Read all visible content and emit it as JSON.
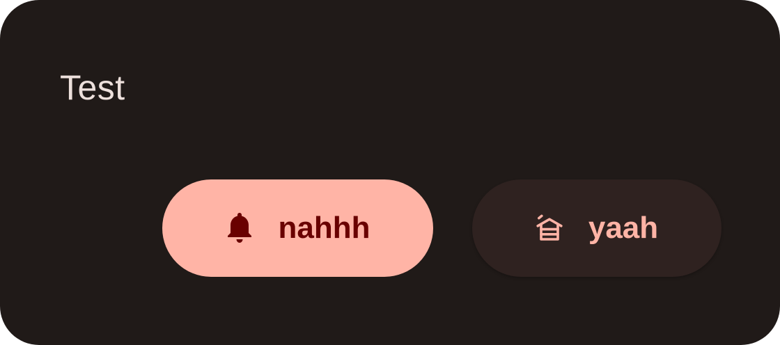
{
  "dialog": {
    "title": "Test"
  },
  "buttons": {
    "primary": {
      "label": "nahhh",
      "icon": "bell-icon"
    },
    "secondary": {
      "label": "yaah",
      "icon": "cabin-icon"
    }
  },
  "colors": {
    "surface": "#201a18",
    "on_surface": "#ede0dc",
    "primary": "#ffb4a6",
    "on_primary": "#690100",
    "secondary_container": "#2f2220"
  }
}
